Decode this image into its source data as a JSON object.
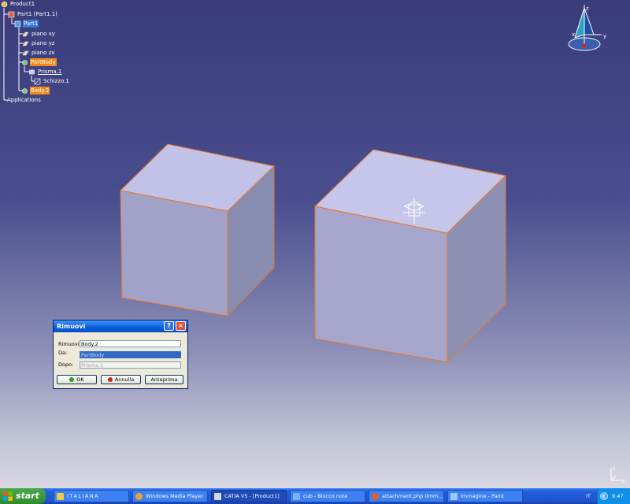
{
  "tree": {
    "product": "Product1",
    "part_instance": "Part1 (Part1.1)",
    "part": "Part1",
    "planes": [
      "piano xy",
      "piano yz",
      "piano zx"
    ],
    "partbody": "PartBody",
    "pad": "Prisma.1",
    "sketch": "Schizzo.1",
    "body2": "Body.2",
    "applications": "Applications"
  },
  "compass": {
    "z": "z",
    "x": "x",
    "y": "y"
  },
  "dialog": {
    "title": "Rimuovi",
    "rows": [
      {
        "label": "Rimuovi",
        "value": "Body.2"
      },
      {
        "label": "Da:",
        "value": "PartBody"
      },
      {
        "label": "Dopo:",
        "value": "Prisma.1"
      }
    ],
    "buttons": {
      "ok": "OK",
      "cancel": "Annulla",
      "preview": "Anteprima"
    },
    "help": "?",
    "close": "×"
  },
  "axis": {
    "x": "x",
    "y": "y"
  },
  "taskbar": {
    "start": "start",
    "tasks": [
      {
        "label": "ITALIANA",
        "color": "#f2c84b"
      },
      {
        "label": "Windows Media Player",
        "color": "#f0a030"
      },
      {
        "label": "CATIA V5 - [Product1]",
        "color": "#d8d8d8"
      },
      {
        "label": "cub - Blocco note",
        "color": "#7fb0ff"
      },
      {
        "label": "attachment.php (Imm...",
        "color": "#e06030"
      },
      {
        "label": "Immagine - Paint",
        "color": "#a0c8ff"
      }
    ],
    "lang": "IT",
    "time": "9.47"
  }
}
